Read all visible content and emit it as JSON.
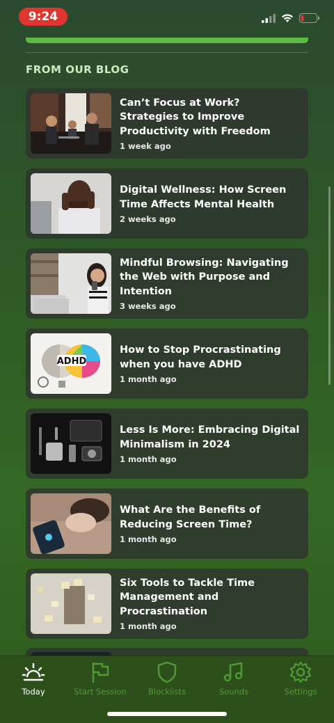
{
  "status_bar": {
    "time": "9:24",
    "battery_color": "#e0362f"
  },
  "section_title": "FROM OUR BLOG",
  "blog_posts": [
    {
      "title": "Can’t Focus at Work? Strategies to Improve Productivity with Freedom",
      "date": "1 week ago",
      "image": "office-meeting-photo"
    },
    {
      "title": "Digital Wellness: How Screen Time Affects Mental Health",
      "date": "2 weeks ago",
      "image": "stressed-man-laptop-photo"
    },
    {
      "title": "Mindful Browsing: Navigating the Web with Purpose and Intention",
      "date": "3 weeks ago",
      "image": "woman-phone-photo"
    },
    {
      "title": "How to Stop Procrastinating when you have ADHD",
      "date": "1 month ago",
      "image": "adhd-brain-illustration",
      "image_text": "ADHD"
    },
    {
      "title": "Less Is More: Embracing Digital Minimalism in 2024",
      "date": "1 month ago",
      "image": "desk-gadgets-photo"
    },
    {
      "title": "What Are the Benefits of Reducing Screen Time?",
      "date": "1 month ago",
      "image": "person-sleeping-phone-photo"
    },
    {
      "title": "Six Tools to Tackle Time Management and Procrastination",
      "date": "1 month ago",
      "image": "sticky-notes-photo"
    }
  ],
  "tabs": [
    {
      "label": "Today",
      "icon": "sunrise-icon",
      "active": true
    },
    {
      "label": "Start Session",
      "icon": "flag-icon",
      "active": false
    },
    {
      "label": "Blocklists",
      "icon": "shield-icon",
      "active": false
    },
    {
      "label": "Sounds",
      "icon": "music-note-icon",
      "active": false
    },
    {
      "label": "Settings",
      "icon": "gear-icon",
      "active": false
    }
  ],
  "colors": {
    "accent_green": "#5db844",
    "inactive_tab": "#4f9a34",
    "card_bg": "#303430"
  }
}
